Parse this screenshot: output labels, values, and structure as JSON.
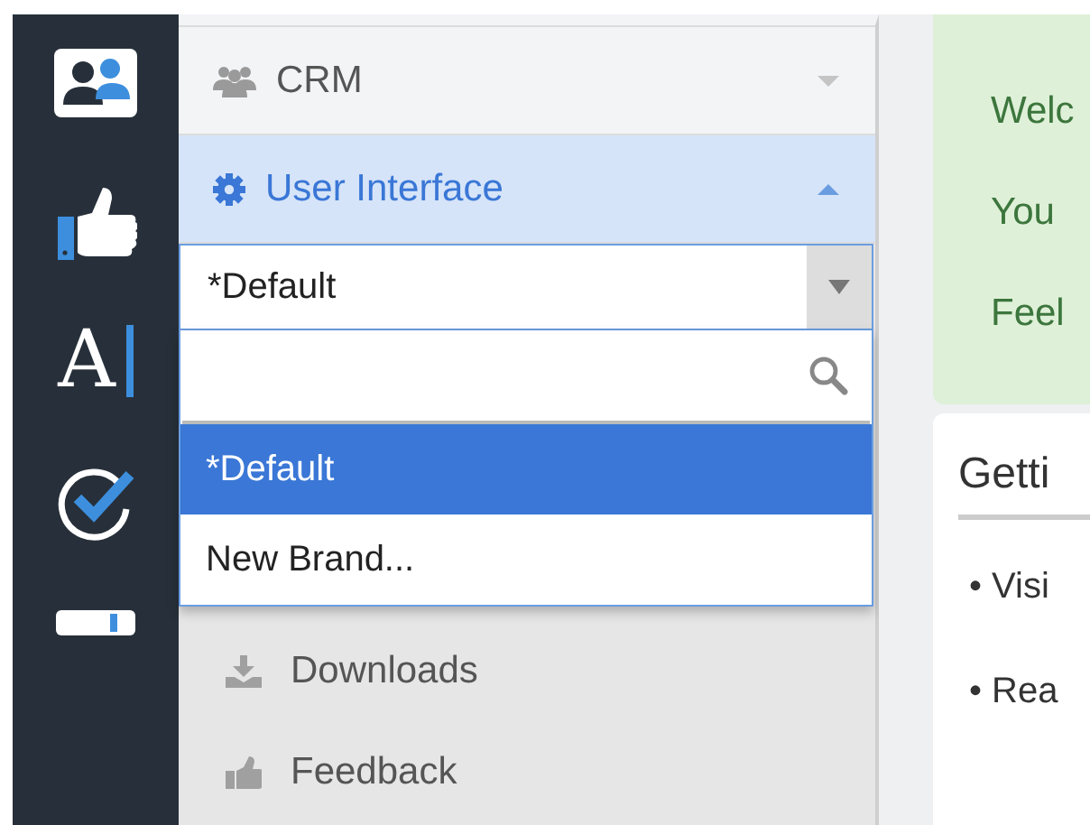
{
  "rail": {
    "items": [
      {
        "kind": "contacts",
        "selected": false
      },
      {
        "kind": "thumb",
        "selected": false
      },
      {
        "kind": "letter",
        "label": "A",
        "selected": false
      },
      {
        "kind": "check",
        "selected": false
      },
      {
        "kind": "partial",
        "selected": false
      }
    ]
  },
  "sidebar": {
    "sections": [
      {
        "kind": "people",
        "label": "CRM",
        "expanded": false
      },
      {
        "kind": "gear",
        "label": "User Interface",
        "expanded": true
      }
    ],
    "brand_select": {
      "value": "*Default",
      "open": true,
      "options": [
        {
          "label": "*Default",
          "selected": true
        },
        {
          "label": "New Brand...",
          "selected": false
        }
      ]
    },
    "links": [
      {
        "kind": "download",
        "label": "Downloads"
      },
      {
        "kind": "thumb",
        "label": "Feedback"
      }
    ]
  },
  "welcome_card": {
    "lines": [
      "Welc",
      "You",
      "Feel"
    ]
  },
  "getting_started": {
    "title": "Getti",
    "items": [
      "• Visi",
      "• Rea"
    ]
  }
}
